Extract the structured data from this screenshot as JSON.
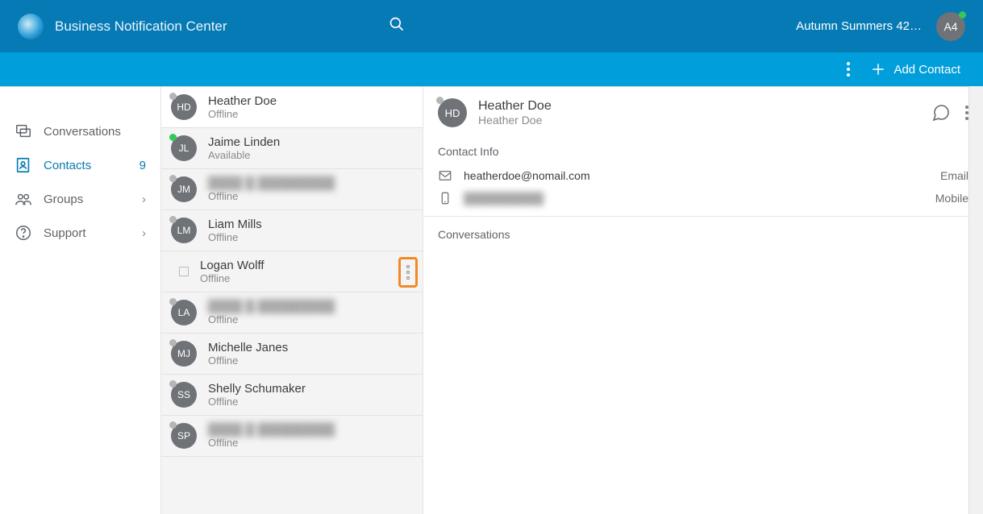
{
  "header": {
    "app_title": "Business Notification Center",
    "username_display": "Autumn Summers 42…",
    "avatar_initials": "A4"
  },
  "subbar": {
    "add_contact_label": "Add Contact"
  },
  "sidebar": {
    "items": [
      {
        "id": "conversations",
        "label": "Conversations",
        "count": null,
        "chevron": false
      },
      {
        "id": "contacts",
        "label": "Contacts",
        "count": "9",
        "chevron": false
      },
      {
        "id": "groups",
        "label": "Groups",
        "count": null,
        "chevron": true
      },
      {
        "id": "support",
        "label": "Support",
        "count": null,
        "chevron": true
      }
    ],
    "active_id": "contacts"
  },
  "contacts": [
    {
      "initials": "HD",
      "name": "Heather Doe",
      "status": "Offline",
      "presence": "grey",
      "selected": true,
      "blurred": false,
      "checkbox": false,
      "menu_highlight": false
    },
    {
      "initials": "JL",
      "name": "Jaime Linden",
      "status": "Available",
      "presence": "green",
      "selected": false,
      "blurred": false,
      "checkbox": false,
      "menu_highlight": false
    },
    {
      "initials": "JM",
      "name": "████ █ █████████",
      "status": "Offline",
      "presence": "grey",
      "selected": false,
      "blurred": true,
      "checkbox": false,
      "menu_highlight": false
    },
    {
      "initials": "LM",
      "name": "Liam Mills",
      "status": "Offline",
      "presence": "grey",
      "selected": false,
      "blurred": false,
      "checkbox": false,
      "menu_highlight": false
    },
    {
      "initials": "",
      "name": "Logan Wolff",
      "status": "Offline",
      "presence": "",
      "selected": false,
      "blurred": false,
      "checkbox": true,
      "menu_highlight": true
    },
    {
      "initials": "LA",
      "name": "████ █ █████████",
      "status": "Offline",
      "presence": "grey",
      "selected": false,
      "blurred": true,
      "checkbox": false,
      "menu_highlight": false
    },
    {
      "initials": "MJ",
      "name": "Michelle Janes",
      "status": "Offline",
      "presence": "grey",
      "selected": false,
      "blurred": false,
      "checkbox": false,
      "menu_highlight": false
    },
    {
      "initials": "SS",
      "name": "Shelly Schumaker",
      "status": "Offline",
      "presence": "grey",
      "selected": false,
      "blurred": false,
      "checkbox": false,
      "menu_highlight": false
    },
    {
      "initials": "SP",
      "name": "████ █ █████████",
      "status": "Offline",
      "presence": "grey",
      "selected": false,
      "blurred": true,
      "checkbox": false,
      "menu_highlight": false
    }
  ],
  "detail": {
    "avatar_initials": "HD",
    "name": "Heather Doe",
    "subtitle": "Heather Doe",
    "sections": {
      "contact_info_label": "Contact Info",
      "conversations_label": "Conversations"
    },
    "info": [
      {
        "icon": "mail",
        "value": "heatherdoe@nomail.com",
        "type": "Email",
        "blurred": false
      },
      {
        "icon": "mobile",
        "value": "██████████",
        "type": "Mobile",
        "blurred": true
      }
    ]
  }
}
